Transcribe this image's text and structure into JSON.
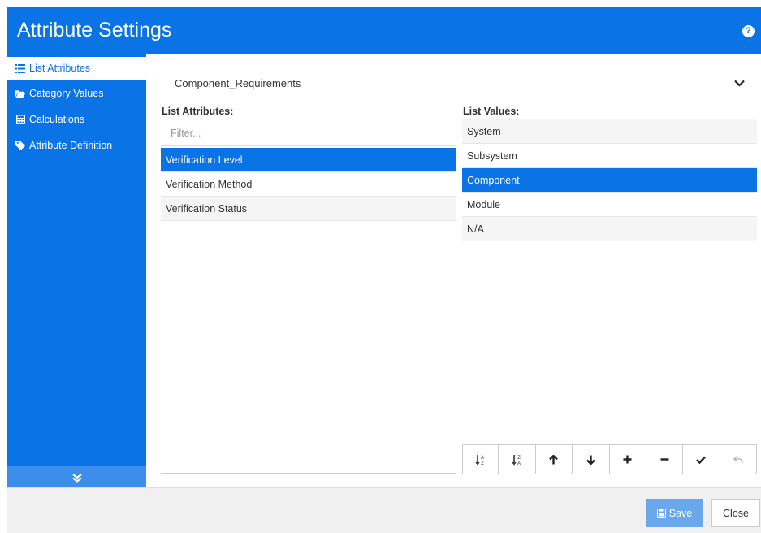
{
  "header": {
    "title": "Attribute Settings",
    "help_icon": "question-circle-icon"
  },
  "sidebar": {
    "items": [
      {
        "label": "List Attributes",
        "icon": "list-icon",
        "active": true
      },
      {
        "label": "Category Values",
        "icon": "folder-icon",
        "active": false
      },
      {
        "label": "Calculations",
        "icon": "calculator-icon",
        "active": false
      },
      {
        "label": "Attribute Definition",
        "icon": "tag-icon",
        "active": false
      }
    ],
    "expander_icon": "double-chevron-down-icon"
  },
  "dropdown": {
    "value": "Component_Requirements"
  },
  "list_attributes": {
    "label": "List Attributes:",
    "filter_placeholder": "Filter...",
    "items": [
      "Verification Level",
      "Verification Method",
      "Verification Status"
    ],
    "selected": "Verification Level"
  },
  "list_values": {
    "label": "List Values:",
    "items": [
      "System",
      "Subsystem",
      "Component",
      "Module",
      "N/A"
    ],
    "selected": "Component"
  },
  "toolbar": {
    "buttons": [
      "sort-ascending-icon",
      "sort-descending-icon",
      "move-up-icon",
      "move-down-icon",
      "add-icon",
      "remove-icon",
      "check-icon",
      "undo-icon"
    ]
  },
  "footer": {
    "save_label": "Save",
    "close_label": "Close"
  },
  "colors": {
    "accent": "#0a73e6",
    "save_disabled": "#6aa8ee"
  }
}
